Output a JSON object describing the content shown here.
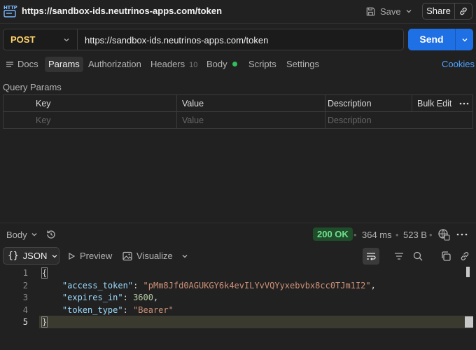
{
  "title_bar": {
    "icon_text": "HTTP",
    "url_title": "https://sandbox-ids.neutrinos-apps.com/token",
    "save_label": "Save",
    "share_label": "Share"
  },
  "request": {
    "method": "POST",
    "url": "https://sandbox-ids.neutrinos-apps.com/token",
    "send_label": "Send"
  },
  "tabs": [
    {
      "label": "Docs"
    },
    {
      "label": "Params",
      "active": true
    },
    {
      "label": "Authorization"
    },
    {
      "label": "Headers",
      "count": "10"
    },
    {
      "label": "Body",
      "indicator": "green-dot"
    },
    {
      "label": "Scripts"
    },
    {
      "label": "Settings"
    }
  ],
  "cookies_label": "Cookies",
  "query_params": {
    "title": "Query Params",
    "columns": [
      "Key",
      "Value",
      "Description"
    ],
    "bulk_edit": "Bulk Edit",
    "placeholders": {
      "key": "Key",
      "value": "Value",
      "description": "Description"
    }
  },
  "response": {
    "view_dropdown": "Body",
    "status": "200 OK",
    "time": "364 ms",
    "size": "523 B",
    "format": "JSON",
    "preview_label": "Preview",
    "visualize_label": "Visualize",
    "lines": [
      {
        "n": "1",
        "text": "{"
      },
      {
        "n": "2",
        "key": "\"access_token\"",
        "value": "\"pMm8Jfd0AGUKGY6k4evILYvVQYyxebvbx8cc0TJm1I2\""
      },
      {
        "n": "3",
        "key": "\"expires_in\"",
        "value": "3600"
      },
      {
        "n": "4",
        "key": "\"token_type\"",
        "value": "\"Bearer\""
      },
      {
        "n": "5",
        "text": "}"
      }
    ]
  },
  "colors": {
    "accent": "#1f6fe5",
    "status_ok": "#6fe08f",
    "method_post": "#ffd369",
    "link": "#4da3ff"
  }
}
